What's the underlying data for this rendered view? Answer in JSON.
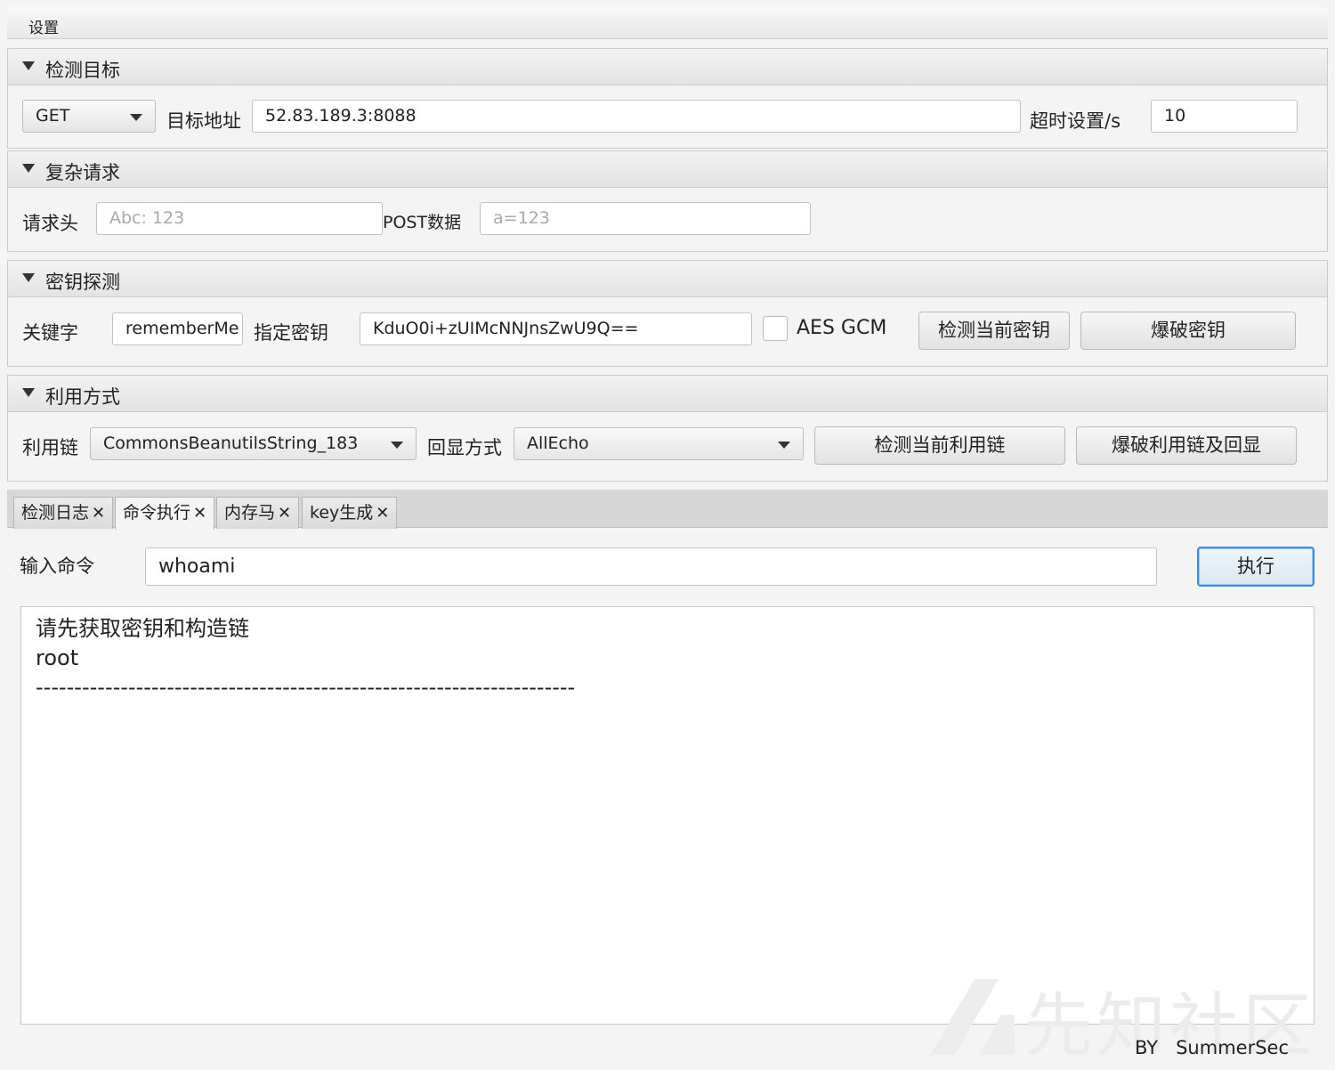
{
  "menubar": {
    "settings": "设置"
  },
  "target": {
    "title": "检测目标",
    "method": "GET",
    "url_label": "目标地址",
    "url": "52.83.189.3:8088",
    "timeout_label": "超时设置/s",
    "timeout": "10"
  },
  "complex": {
    "title": "复杂请求",
    "header_label": "请求头",
    "header_placeholder": "Abc: 123",
    "post_label": "POST数据",
    "post_placeholder": "a=123"
  },
  "key": {
    "title": "密钥探测",
    "keyword_label": "关键字",
    "keyword": "rememberMe",
    "specify_label": "指定密钥",
    "key_value": "KduO0i+zUIMcNNJnsZwU9Q==",
    "aes_gcm_label": "AES GCM",
    "aes_gcm_checked": false,
    "check_button": "检测当前密钥",
    "brute_button": "爆破密钥"
  },
  "exploit": {
    "title": "利用方式",
    "chain_label": "利用链",
    "chain": "CommonsBeanutilsString_183",
    "echo_label": "回显方式",
    "echo": "AllEcho",
    "check_button": "检测当前利用链",
    "brute_button": "爆破利用链及回显"
  },
  "tabs": [
    {
      "label": "检测日志",
      "active": false
    },
    {
      "label": "命令执行",
      "active": true
    },
    {
      "label": "内存马",
      "active": false
    },
    {
      "label": "key生成",
      "active": false
    }
  ],
  "command": {
    "label": "输入命令",
    "value": "whoami",
    "execute_button": "执行"
  },
  "output": {
    "lines": [
      "请先获取密钥和构造链",
      "root",
      "----------------------------------------------------------------------"
    ]
  },
  "footer": {
    "text": "BY   SummerSec"
  },
  "watermark": {
    "text": "先知社区"
  },
  "colors": {
    "focus_border": "#3d8fd6",
    "background": "#f4f4f4"
  }
}
